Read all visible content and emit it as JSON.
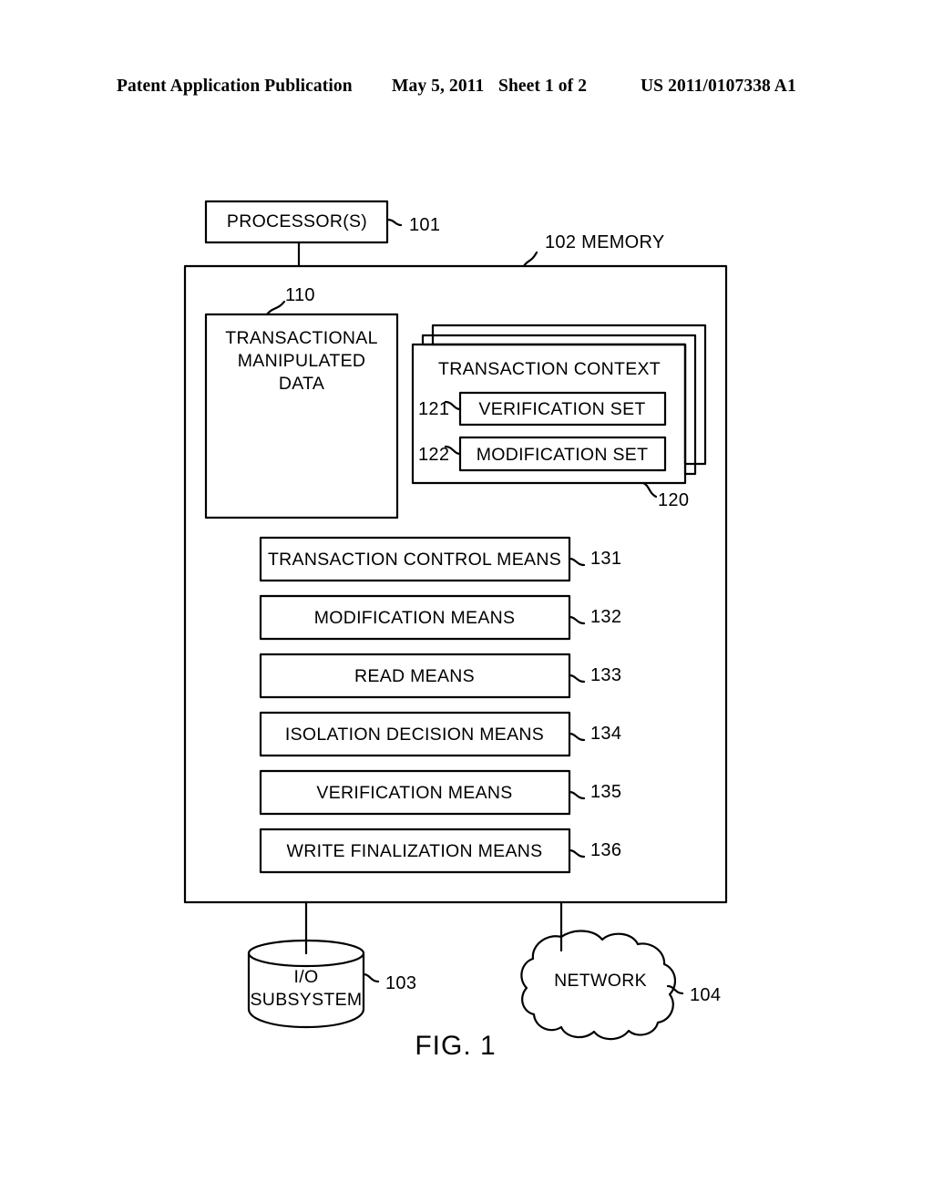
{
  "header": {
    "publication": "Patent Application Publication",
    "date": "May 5, 2011",
    "sheet": "Sheet 1 of 2",
    "number": "US 2011/0107338 A1"
  },
  "figure": {
    "caption": "FIG. 1",
    "processor": {
      "label": "PROCESSOR(S)",
      "ref": "101"
    },
    "memory": {
      "label": "102 MEMORY",
      "ref": "102"
    },
    "transactional_data": {
      "line1": "TRANSACTIONAL",
      "line2": "MANIPULATED",
      "line3": "DATA",
      "ref": "110"
    },
    "transaction_context": {
      "title": "TRANSACTION CONTEXT",
      "ref": "120",
      "items": [
        {
          "label": "VERIFICATION SET",
          "ref": "121"
        },
        {
          "label": "MODIFICATION SET",
          "ref": "122"
        }
      ]
    },
    "means": [
      {
        "label": "TRANSACTION CONTROL MEANS",
        "ref": "131"
      },
      {
        "label": "MODIFICATION MEANS",
        "ref": "132"
      },
      {
        "label": "READ MEANS",
        "ref": "133"
      },
      {
        "label": "ISOLATION DECISION MEANS",
        "ref": "134"
      },
      {
        "label": "VERIFICATION MEANS",
        "ref": "135"
      },
      {
        "label": "WRITE FINALIZATION MEANS",
        "ref": "136"
      }
    ],
    "io_subsystem": {
      "line1": "I/O",
      "line2": "SUBSYSTEM",
      "ref": "103"
    },
    "network": {
      "label": "NETWORK",
      "ref": "104"
    }
  },
  "colors": {
    "ink": "#000000",
    "paper": "#ffffff"
  }
}
